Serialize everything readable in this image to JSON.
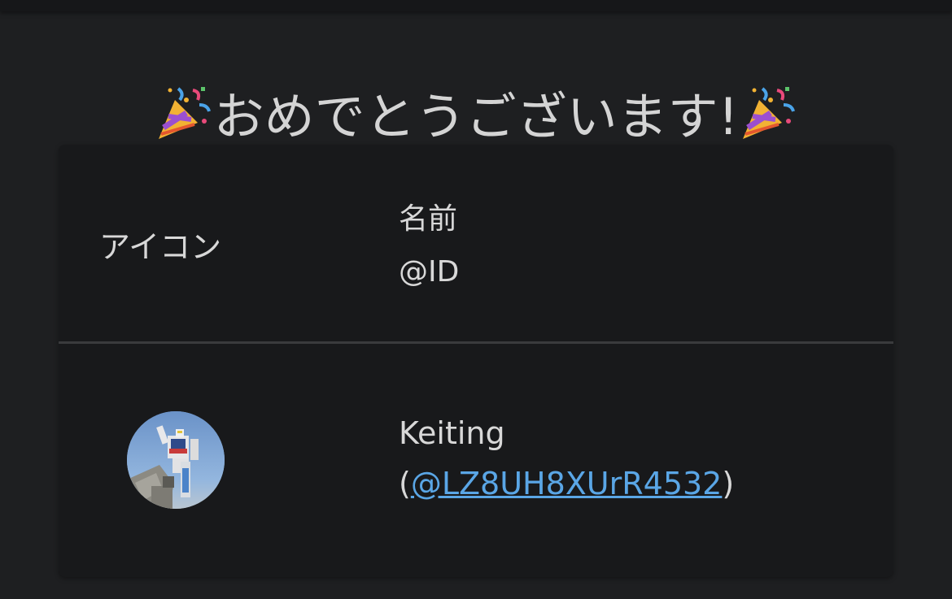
{
  "title": {
    "text": "おめでとうございます!",
    "left_icon": "party-popper-icon",
    "right_icon": "party-popper-icon"
  },
  "table": {
    "headers": {
      "icon": "アイコン",
      "name": "名前",
      "id": "@ID"
    },
    "rows": [
      {
        "avatar": "avatar",
        "name": "Keiting",
        "id_prefix": "(",
        "id_link": "@LZ8UH8XUrR4532",
        "id_suffix": ")"
      }
    ]
  },
  "colors": {
    "background": "#1e1f21",
    "card": "#18191b",
    "text": "#d8d8d8",
    "link": "#5aa6e6",
    "divider": "#3a3b3d"
  }
}
